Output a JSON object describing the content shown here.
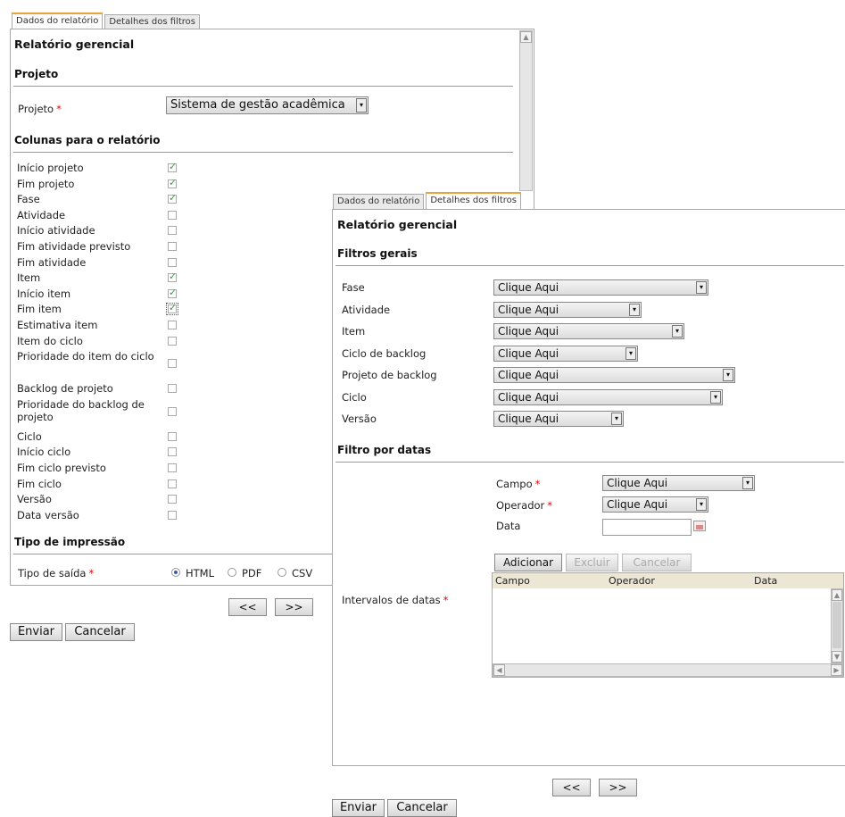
{
  "left": {
    "tabs": [
      "Dados do relatório",
      "Detalhes dos filtros"
    ],
    "title": "Relatório gerencial",
    "project_section": "Projeto",
    "project_label": "Projeto",
    "project_value": "Sistema de gestão acadêmica",
    "columns_section": "Colunas para o relatório",
    "columns": [
      {
        "label": "Início projeto",
        "checked": true
      },
      {
        "label": "Fim projeto",
        "checked": true
      },
      {
        "label": "Fase",
        "checked": true
      },
      {
        "label": "Atividade",
        "checked": false
      },
      {
        "label": "Início atividade",
        "checked": false
      },
      {
        "label": "Fim atividade previsto",
        "checked": false
      },
      {
        "label": "Fim atividade",
        "checked": false
      },
      {
        "label": "Item",
        "checked": true
      },
      {
        "label": "Início item",
        "checked": true
      },
      {
        "label": "Fim item",
        "checked": true
      },
      {
        "label": "Estimativa item",
        "checked": false
      },
      {
        "label": "Item do ciclo",
        "checked": false
      },
      {
        "label": "Prioridade do item do ciclo",
        "checked": false
      },
      {
        "label": "Backlog de projeto",
        "checked": false
      },
      {
        "label": "Prioridade do backlog de projeto",
        "checked": false
      },
      {
        "label": "Ciclo",
        "checked": false
      },
      {
        "label": "Início ciclo",
        "checked": false
      },
      {
        "label": "Fim ciclo previsto",
        "checked": false
      },
      {
        "label": "Fim ciclo",
        "checked": false
      },
      {
        "label": "Versão",
        "checked": false
      },
      {
        "label": "Data versão",
        "checked": false
      }
    ],
    "print_section": "Tipo de impressão",
    "output_label": "Tipo de saída",
    "output_options": [
      "HTML",
      "PDF",
      "CSV"
    ],
    "output_selected": "HTML",
    "prev": "<<",
    "next": ">>",
    "send": "Enviar",
    "cancel": "Cancelar"
  },
  "right": {
    "tabs": [
      "Dados do relatório",
      "Detalhes dos filtros"
    ],
    "title": "Relatório gerencial",
    "general_section": "Filtros gerais",
    "filters": [
      {
        "label": "Fase",
        "value": "Clique Aqui"
      },
      {
        "label": "Atividade",
        "value": "Clique Aqui"
      },
      {
        "label": "Item",
        "value": "Clique Aqui"
      },
      {
        "label": "Ciclo de backlog",
        "value": "Clique Aqui"
      },
      {
        "label": "Projeto de backlog",
        "value": "Clique Aqui"
      },
      {
        "label": "Ciclo",
        "value": "Clique Aqui"
      },
      {
        "label": "Versão",
        "value": "Clique Aqui"
      }
    ],
    "date_section": "Filtro por datas",
    "campo_label": "Campo",
    "campo_value": "Clique Aqui",
    "operador_label": "Operador",
    "operador_value": "Clique Aqui",
    "data_label": "Data",
    "intervals_label": "Intervalos de datas",
    "add": "Adicionar",
    "delete": "Excluir",
    "cancel_grid": "Cancelar",
    "grid_cols": [
      "Campo",
      "Operador",
      "Data"
    ],
    "prev": "<<",
    "next": ">>",
    "send": "Enviar",
    "cancel": "Cancelar"
  }
}
